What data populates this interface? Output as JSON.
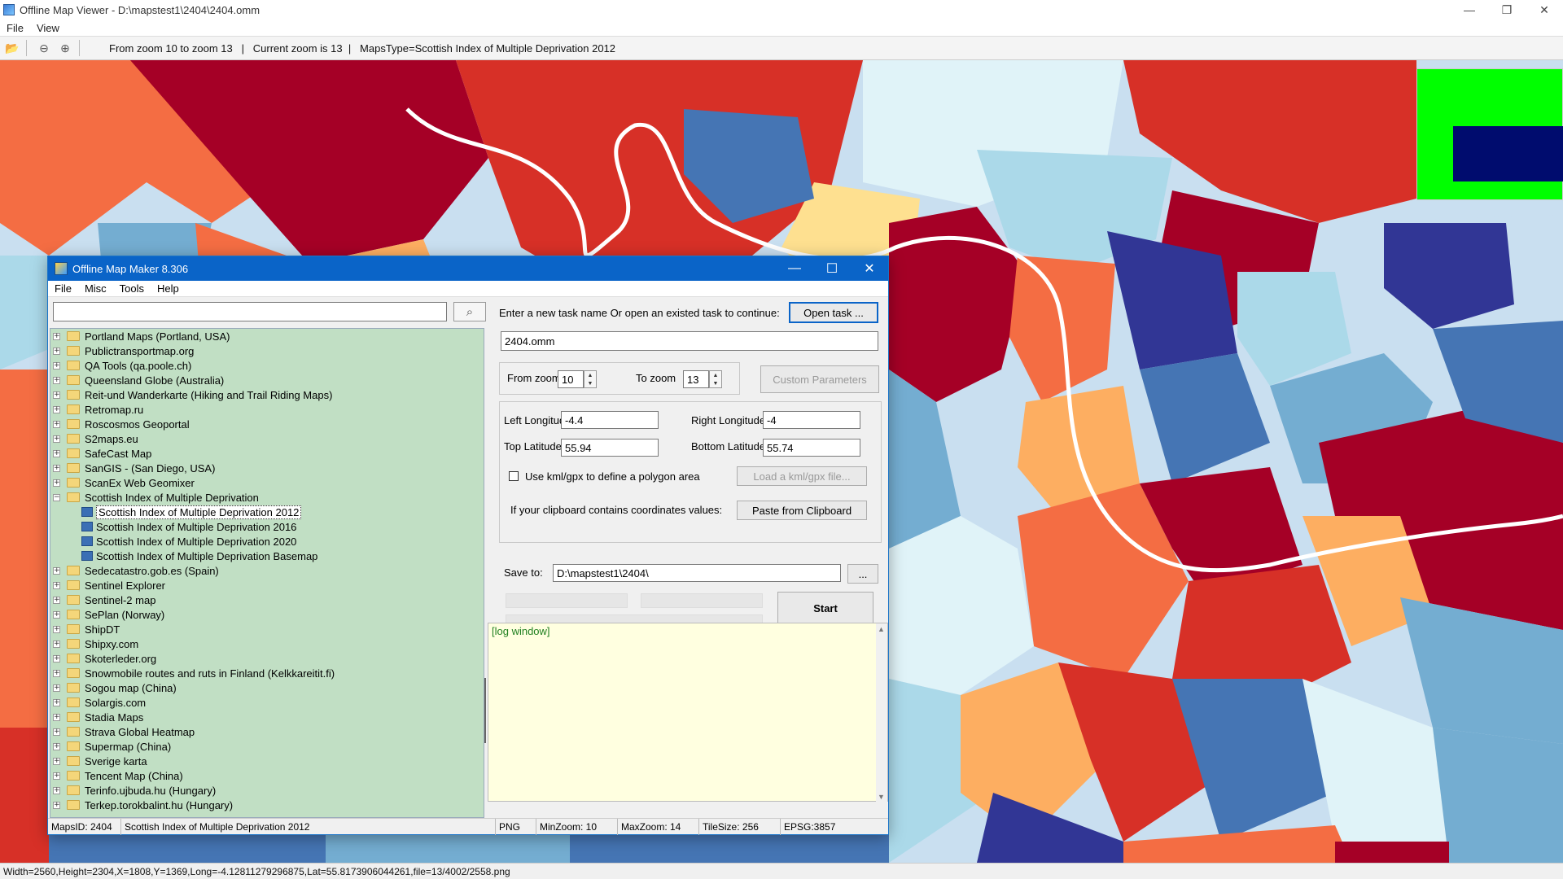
{
  "viewer": {
    "title": "Offline Map Viewer - D:\\mapstest1\\2404\\2404.omm",
    "menu": [
      "File",
      "View"
    ],
    "toolbar_status": "From zoom 10 to zoom 13   |   Current zoom is 13  |   MapsType=Scottish Index of Multiple Deprivation 2012",
    "statusbar": "Width=2560,Height=2304,X=1808,Y=1369,Long=-4.12811279296875,Lat=55.8173906044261,file=13/4002/2558.png",
    "window_controls": {
      "minimize": "—",
      "maximize": "❐",
      "close": "✕"
    }
  },
  "maker": {
    "title": "Offline Map Maker 8.306",
    "menu": [
      "File",
      "Misc",
      "Tools",
      "Help"
    ],
    "window_controls": {
      "minimize": "—",
      "maximize": "☐",
      "close": "✕"
    },
    "search": {
      "value": "",
      "button_icon": "⌕"
    },
    "tree": [
      {
        "label": "Portland Maps (Portland, USA)",
        "type": "folder",
        "expander": "+"
      },
      {
        "label": "Publictransportmap.org",
        "type": "folder",
        "expander": "+"
      },
      {
        "label": "QA Tools (qa.poole.ch)",
        "type": "folder",
        "expander": "+"
      },
      {
        "label": "Queensland Globe (Australia)",
        "type": "folder",
        "expander": "+"
      },
      {
        "label": "Reit-und Wanderkarte (Hiking and Trail Riding Maps)",
        "type": "folder",
        "expander": "+"
      },
      {
        "label": "Retromap.ru",
        "type": "folder",
        "expander": "+"
      },
      {
        "label": "Roscosmos Geoportal",
        "type": "folder",
        "expander": "+"
      },
      {
        "label": "S2maps.eu",
        "type": "folder",
        "expander": "+"
      },
      {
        "label": "SafeCast Map",
        "type": "folder",
        "expander": "+"
      },
      {
        "label": "SanGIS - (San Diego, USA)",
        "type": "folder",
        "expander": "+"
      },
      {
        "label": "ScanEx Web Geomixer",
        "type": "folder",
        "expander": "+"
      },
      {
        "label": "Scottish Index of Multiple Deprivation",
        "type": "folder",
        "expander": "−"
      },
      {
        "label": "Scottish Index of Multiple Deprivation 2012",
        "type": "map",
        "selected": true
      },
      {
        "label": "Scottish Index of Multiple Deprivation 2016",
        "type": "map"
      },
      {
        "label": "Scottish Index of Multiple Deprivation 2020",
        "type": "map"
      },
      {
        "label": "Scottish Index of Multiple Deprivation Basemap",
        "type": "map"
      },
      {
        "label": "Sedecatastro.gob.es (Spain)",
        "type": "folder",
        "expander": "+"
      },
      {
        "label": "Sentinel Explorer",
        "type": "folder",
        "expander": "+"
      },
      {
        "label": "Sentinel-2 map",
        "type": "folder",
        "expander": "+"
      },
      {
        "label": "SePlan (Norway)",
        "type": "folder",
        "expander": "+"
      },
      {
        "label": "ShipDT",
        "type": "folder",
        "expander": "+"
      },
      {
        "label": "Shipxy.com",
        "type": "folder",
        "expander": "+"
      },
      {
        "label": "Skoterleder.org",
        "type": "folder",
        "expander": "+"
      },
      {
        "label": "Snowmobile routes and ruts in Finland (Kelkkareitit.fi)",
        "type": "folder",
        "expander": "+"
      },
      {
        "label": "Sogou map (China)",
        "type": "folder",
        "expander": "+"
      },
      {
        "label": "Solargis.com",
        "type": "folder",
        "expander": "+"
      },
      {
        "label": "Stadia Maps",
        "type": "folder",
        "expander": "+"
      },
      {
        "label": "Strava Global Heatmap",
        "type": "folder",
        "expander": "+"
      },
      {
        "label": "Supermap (China)",
        "type": "folder",
        "expander": "+"
      },
      {
        "label": "Sverige karta",
        "type": "folder",
        "expander": "+"
      },
      {
        "label": "Tencent Map (China)",
        "type": "folder",
        "expander": "+"
      },
      {
        "label": "Terinfo.ujbuda.hu (Hungary)",
        "type": "folder",
        "expander": "+"
      },
      {
        "label": "Terkep.torokbalint.hu (Hungary)",
        "type": "folder",
        "expander": "+"
      }
    ],
    "task": {
      "prompt": "Enter a new task name Or open an existed task to continue:",
      "open_button": "Open task ...",
      "name_value": "2404.omm"
    },
    "zoom": {
      "from_label": "From zoom",
      "from_value": "10",
      "to_label": "To zoom",
      "to_value": "13",
      "custom_button": "Custom Parameters"
    },
    "coords": {
      "left_lon_label": "Left Longitude",
      "left_lon_value": "-4.4",
      "right_lon_label": "Right Longitude",
      "right_lon_value": "-4",
      "top_lat_label": "Top Latitude",
      "top_lat_value": "55.94",
      "bottom_lat_label": "Bottom Latitude",
      "bottom_lat_value": "55.74",
      "kml_label": "Use kml/gpx to define a polygon area",
      "kml_checked": false,
      "kml_button": "Load a kml/gpx file...",
      "clipboard_label": "If your clipboard contains coordinates values:",
      "clipboard_button": "Paste from Clipboard"
    },
    "save": {
      "label": "Save to:",
      "value": "D:\\mapstest1\\2404\\",
      "browse_button": "...",
      "start_button": "Start"
    },
    "progress": [
      0,
      0,
      0
    ],
    "log_text": "[log window]",
    "statusbar": {
      "maps_id": "MapsID: 2404",
      "map_name": "Scottish Index of Multiple Deprivation 2012",
      "format": "PNG",
      "min_zoom": "MinZoom: 10",
      "max_zoom": "MaxZoom: 14",
      "tile_size": "TileSize: 256",
      "epsg": "EPSG:3857"
    }
  }
}
